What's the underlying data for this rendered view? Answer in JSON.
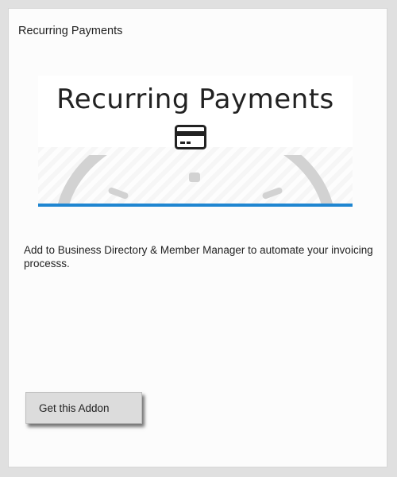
{
  "addon": {
    "title": "Recurring Payments",
    "banner_heading": "Recurring Payments",
    "description": "Add to Business Directory & Member Manager to automate your invoicing processs.",
    "button_label": "Get this Addon"
  },
  "colors": {
    "accent_line": "#1f86d1",
    "button_bg": "#dcdcdc",
    "page_bg": "#e0e0e0"
  },
  "icons": {
    "banner_icon": "credit-card-icon",
    "banner_graphic": "gauge-arc"
  }
}
